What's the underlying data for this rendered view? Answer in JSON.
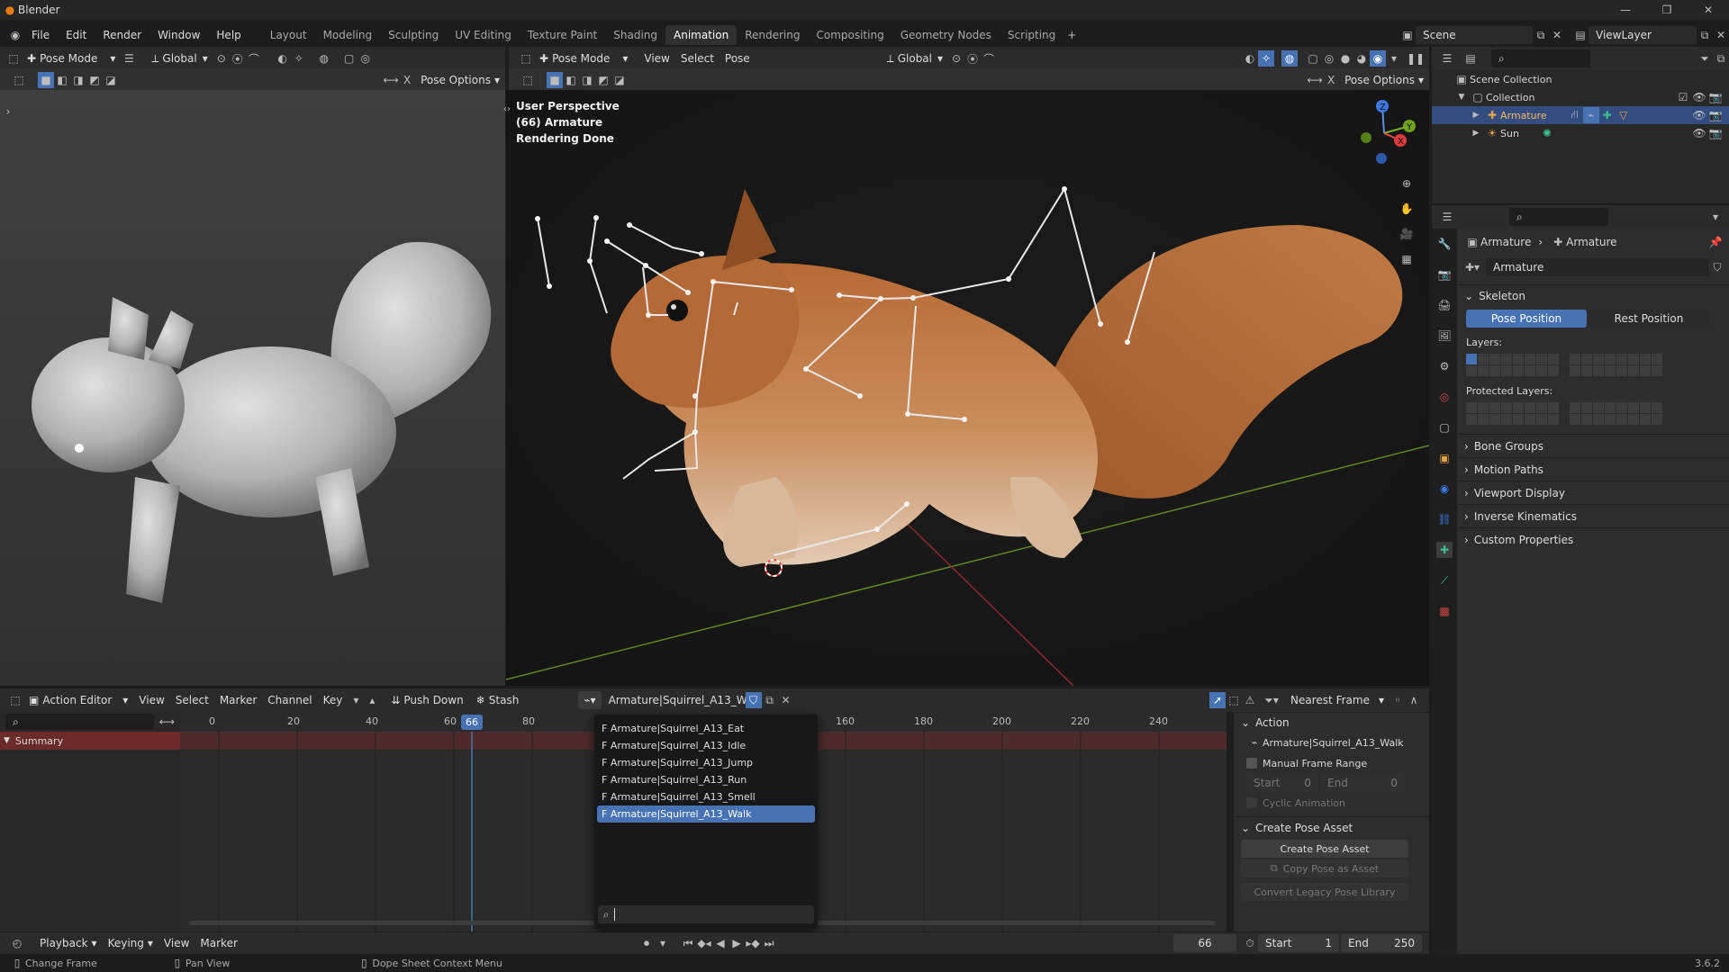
{
  "app": {
    "title": "Blender",
    "version": "3.6.2"
  },
  "menubar": {
    "items": [
      "File",
      "Edit",
      "Render",
      "Window",
      "Help"
    ],
    "workspaces": [
      "Layout",
      "Modeling",
      "Sculpting",
      "UV Editing",
      "Texture Paint",
      "Shading",
      "Animation",
      "Rendering",
      "Compositing",
      "Geometry Nodes",
      "Scripting"
    ],
    "active_workspace": "Animation",
    "scene": "Scene",
    "view_layer": "ViewLayer"
  },
  "left_view": {
    "mode": "Pose Mode",
    "transform": "Global",
    "pose_options": "Pose Options"
  },
  "main_view": {
    "mode": "Pose Mode",
    "menus": [
      "View",
      "Select",
      "Pose"
    ],
    "transform": "Global",
    "pose_options": "Pose Options",
    "overlay_lines": [
      "User Perspective",
      "(66) Armature",
      "Rendering Done"
    ]
  },
  "outliner": {
    "root": "Scene Collection",
    "collection": "Collection",
    "items": [
      "Armature",
      "Sun"
    ]
  },
  "properties": {
    "breadcrumb": [
      "Armature",
      "Armature"
    ],
    "data_name": "Armature",
    "skeleton": "Skeleton",
    "pose_position": "Pose Position",
    "rest_position": "Rest Position",
    "layers_label": "Layers:",
    "protected_layers_label": "Protected Layers:",
    "panels": [
      "Bone Groups",
      "Motion Paths",
      "Viewport Display",
      "Inverse Kinematics",
      "Custom Properties"
    ]
  },
  "action_editor": {
    "editor": "Action Editor",
    "menus": [
      "View",
      "Select",
      "Marker",
      "Channel",
      "Key"
    ],
    "push_down": "Push Down",
    "stash": "Stash",
    "action": "Armature|Squirrel_A13_Walk",
    "snap": "Nearest Frame",
    "summary": "Summary",
    "ruler": [
      "0",
      "20",
      "40",
      "60",
      "80",
      "160",
      "180",
      "200",
      "220",
      "240"
    ],
    "current_frame": "66",
    "actions_list": [
      "F Armature|Squirrel_A13_Eat",
      "F Armature|Squirrel_A13_Idle",
      "F Armature|Squirrel_A13_Jump",
      "F Armature|Squirrel_A13_Run",
      "F Armature|Squirrel_A13_Smell",
      "F Armature|Squirrel_A13_Walk"
    ],
    "selected_action_index": 5,
    "sidebar": {
      "action_title": "Action",
      "action_name": "Armature|Squirrel_A13_Walk",
      "manual_frame_range": "Manual Frame Range",
      "start_label": "Start",
      "start_value": "0",
      "end_label": "End",
      "end_value": "0",
      "cyclic": "Cyclic Animation",
      "pose_asset_title": "Create Pose Asset",
      "create_pose_asset": "Create Pose Asset",
      "copy_pose": "Copy Pose as Asset",
      "convert": "Convert Legacy Pose Library"
    }
  },
  "timeline": {
    "menus": [
      "Playback",
      "Keying",
      "View",
      "Marker"
    ],
    "frame": "66",
    "start_label": "Start",
    "start": "1",
    "end_label": "End",
    "end": "250"
  },
  "status": {
    "left": "Change Frame",
    "middle": "Pan View",
    "right": "Dope Sheet Context Menu"
  }
}
